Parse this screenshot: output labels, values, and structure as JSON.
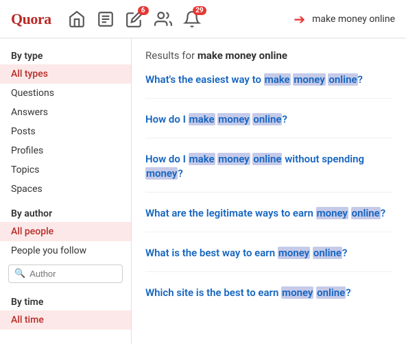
{
  "header": {
    "logo": "Quora",
    "search_query": "make money online",
    "badges": {
      "edit": "6",
      "notifications": "29"
    }
  },
  "sidebar": {
    "by_type_label": "By type",
    "type_items": [
      {
        "label": "All types",
        "active": true
      },
      {
        "label": "Questions",
        "active": false
      },
      {
        "label": "Answers",
        "active": false
      },
      {
        "label": "Posts",
        "active": false
      },
      {
        "label": "Profiles",
        "active": false
      },
      {
        "label": "Topics",
        "active": false
      },
      {
        "label": "Spaces",
        "active": false
      }
    ],
    "by_author_label": "By author",
    "author_items": [
      {
        "label": "All people",
        "active": true
      },
      {
        "label": "People you follow",
        "active": false
      }
    ],
    "author_search_placeholder": "Author",
    "by_time_label": "By time",
    "time_items": [
      {
        "label": "All time",
        "active": true
      }
    ]
  },
  "results": {
    "title_prefix": "Results for ",
    "query": "make money online",
    "items": [
      {
        "text": "What's the easiest way to make money online?",
        "highlights": [
          "make",
          "money",
          "online"
        ]
      },
      {
        "text": "How do I make money online?",
        "highlights": [
          "make",
          "money",
          "online"
        ]
      },
      {
        "text": "How do I make money online without spending money?",
        "highlights": [
          "make",
          "money",
          "online",
          "money"
        ]
      },
      {
        "text": "What are the legitimate ways to earn money online?",
        "highlights": [
          "money",
          "online"
        ]
      },
      {
        "text": "What is the best way to earn money online?",
        "highlights": [
          "money",
          "online"
        ]
      },
      {
        "text": "Which site is the best to earn money online?",
        "highlights": [
          "money",
          "online"
        ]
      }
    ]
  }
}
